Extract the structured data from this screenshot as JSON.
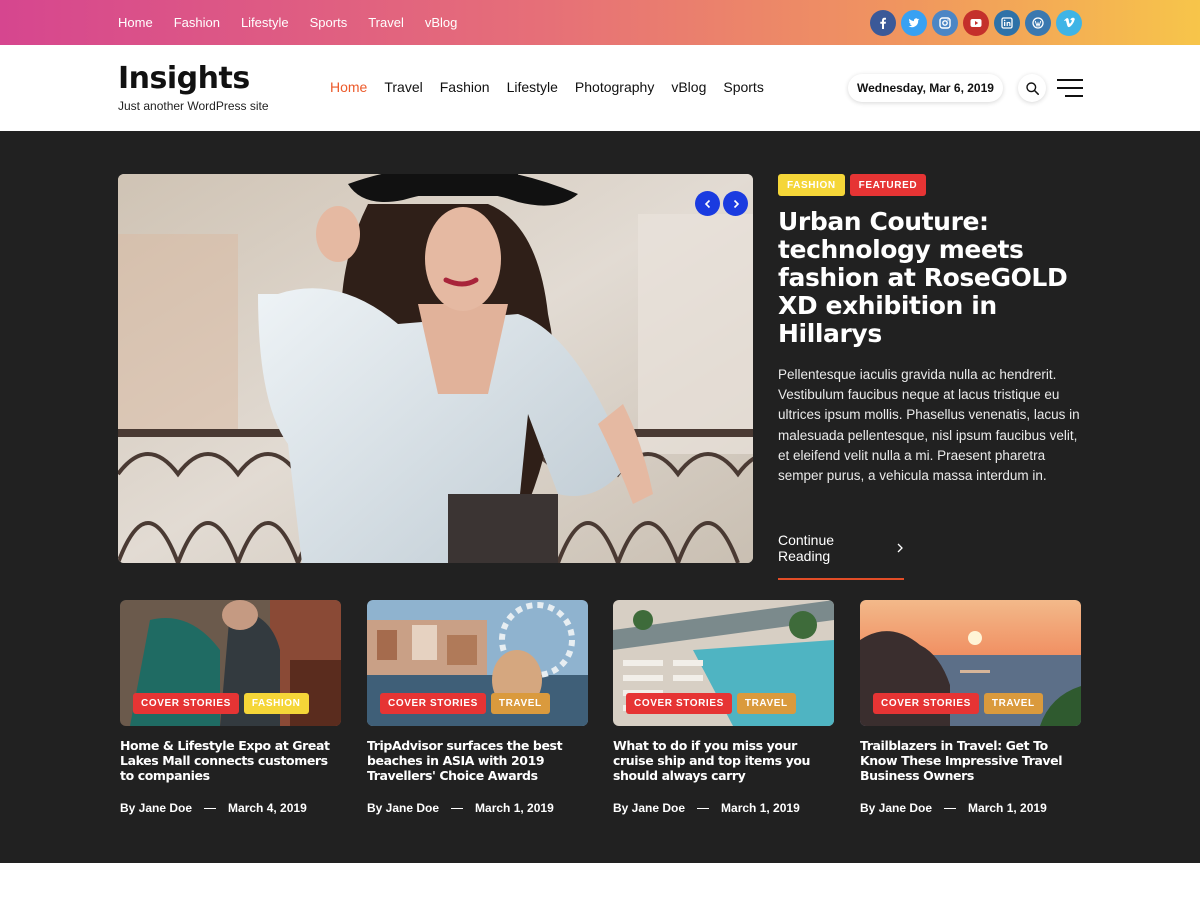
{
  "topbar": {
    "nav": [
      "Home",
      "Fashion",
      "Lifestyle",
      "Sports",
      "Travel",
      "vBlog"
    ],
    "social": [
      {
        "icon": "facebook-icon",
        "glyph": "f",
        "color": "#3b5998"
      },
      {
        "icon": "twitter-icon",
        "glyph": "t",
        "color": "#38a1f3"
      },
      {
        "icon": "instagram-icon",
        "glyph": "ig",
        "color": "#4c86c5"
      },
      {
        "icon": "youtube-icon",
        "glyph": "yt",
        "color": "#c4302b"
      },
      {
        "icon": "linkedin-icon",
        "glyph": "in",
        "color": "#2e72a8"
      },
      {
        "icon": "wordpress-icon",
        "glyph": "wp",
        "color": "#3a78b0"
      },
      {
        "icon": "vimeo-icon",
        "glyph": "v",
        "color": "#3fb4e6"
      }
    ]
  },
  "header": {
    "site_title": "Insights",
    "tagline": "Just another WordPress site",
    "nav": [
      "Home",
      "Travel",
      "Fashion",
      "Lifestyle",
      "Photography",
      "vBlog",
      "Sports"
    ],
    "active_nav": "Home",
    "date": "Wednesday, Mar 6, 2019"
  },
  "hero": {
    "badges": [
      "FASHION",
      "FEATURED"
    ],
    "title": "Urban Couture: technology meets fashion at RoseGOLD XD exhibition in Hillarys",
    "excerpt": "Pellentesque iaculis gravida nulla ac hendrerit. Vestibulum faucibus neque at lacus tristique eu ultrices ipsum mollis. Phasellus venenatis, lacus in malesuada pellentesque, nisl ipsum faucibus velit, et eleifend velit nulla a mi. Praesent pharetra semper purus, a vehicula massa interdum in.",
    "continue": "Continue Reading"
  },
  "cards": [
    {
      "badges": [
        "COVER STORIES",
        "FASHION"
      ],
      "title": "Home & Lifestyle Expo at Great Lakes Mall connects customers to companies",
      "author": "By Jane Doe",
      "date": "March 4, 2019"
    },
    {
      "badges": [
        "COVER STORIES",
        "TRAVEL"
      ],
      "title": "TripAdvisor surfaces the best beaches in ASIA with 2019 Travellers' Choice Awards",
      "author": "By Jane Doe",
      "date": "March 1, 2019"
    },
    {
      "badges": [
        "COVER STORIES",
        "TRAVEL"
      ],
      "title": "What to do if you miss your cruise ship and top items you should always carry",
      "author": "By Jane Doe",
      "date": "March 1, 2019"
    },
    {
      "badges": [
        "COVER STORIES",
        "TRAVEL"
      ],
      "title": "Trailblazers in Travel: Get To Know These Impressive Travel Business Owners",
      "author": "By Jane Doe",
      "date": "March 1, 2019"
    }
  ],
  "colors": {
    "accent": "#ec5a2a",
    "dark_bg": "#212121",
    "badge_yellow": "#f5d638",
    "badge_red": "#e63434",
    "badge_orange": "#da9a3d",
    "slider_arrow": "#1a3be0"
  }
}
